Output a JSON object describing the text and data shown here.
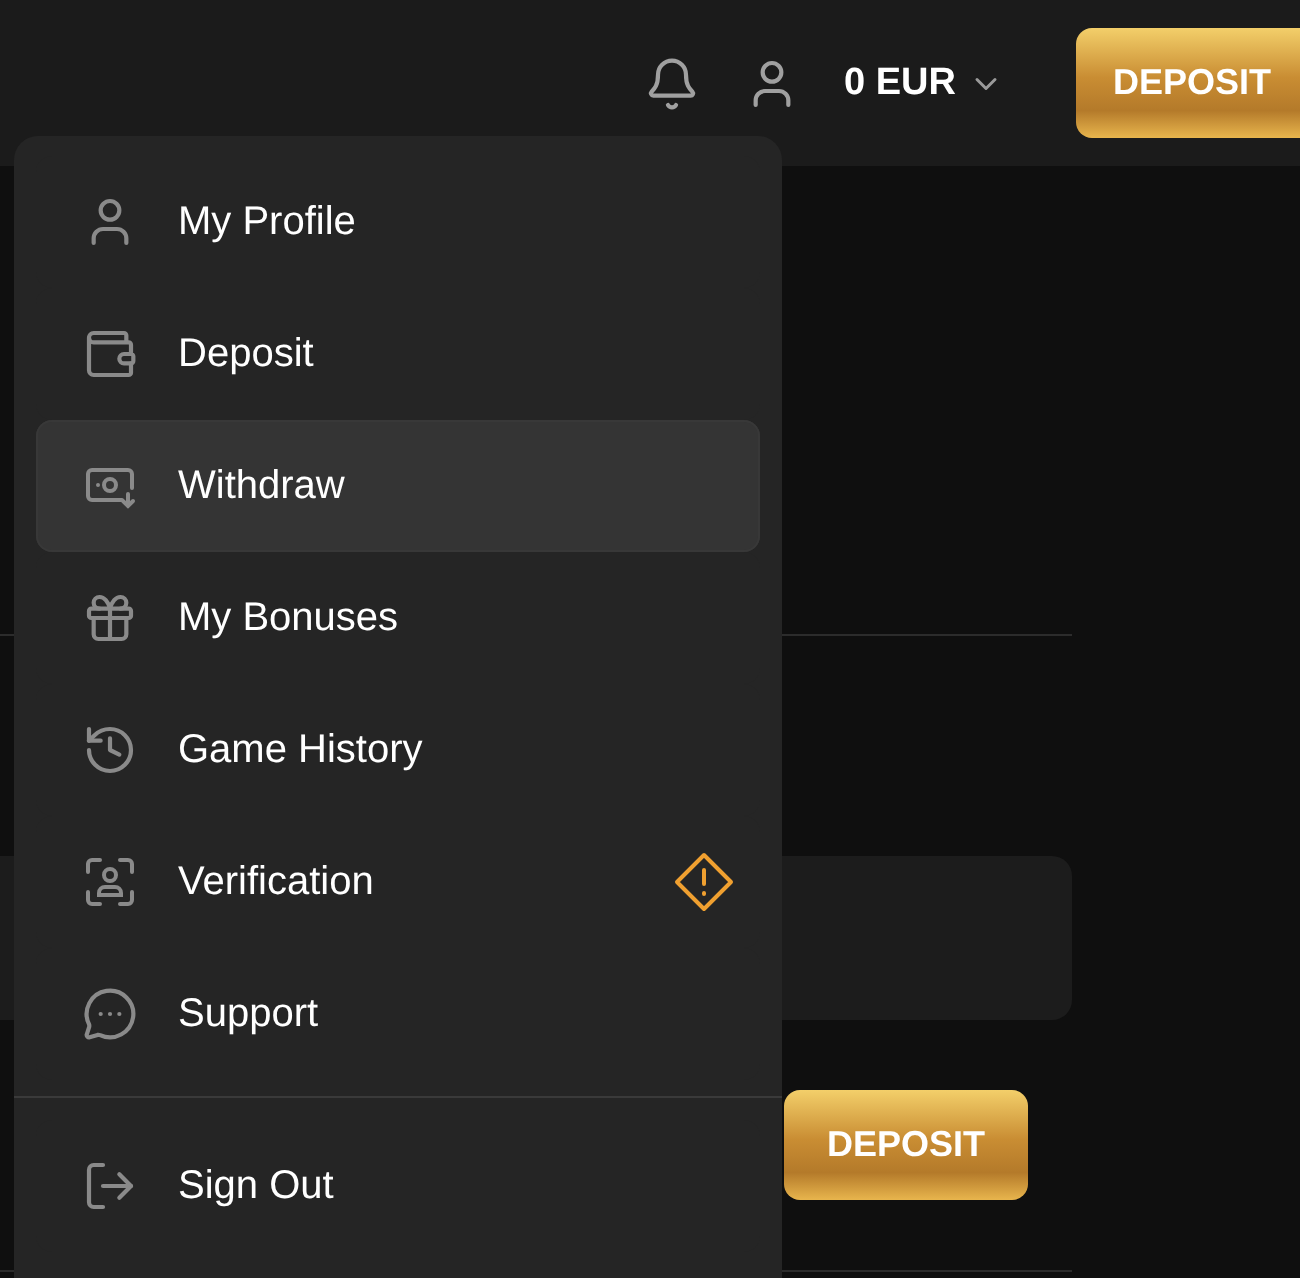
{
  "header": {
    "balance": "0 EUR",
    "deposit_button": "DEPOSIT"
  },
  "background": {
    "deposit_button": "DEPOSIT"
  },
  "account_menu": {
    "items": [
      {
        "kind": "profile",
        "label": "My Profile",
        "selected": false,
        "warning": false
      },
      {
        "kind": "deposit",
        "label": "Deposit",
        "selected": false,
        "warning": false
      },
      {
        "kind": "withdraw",
        "label": "Withdraw",
        "selected": true,
        "warning": false
      },
      {
        "kind": "bonuses",
        "label": "My Bonuses",
        "selected": false,
        "warning": false
      },
      {
        "kind": "history",
        "label": "Game History",
        "selected": false,
        "warning": false
      },
      {
        "kind": "verification",
        "label": "Verification",
        "selected": false,
        "warning": true
      },
      {
        "kind": "support",
        "label": "Support",
        "selected": false,
        "warning": false
      }
    ],
    "sign_out": {
      "kind": "signout",
      "label": "Sign Out"
    }
  }
}
